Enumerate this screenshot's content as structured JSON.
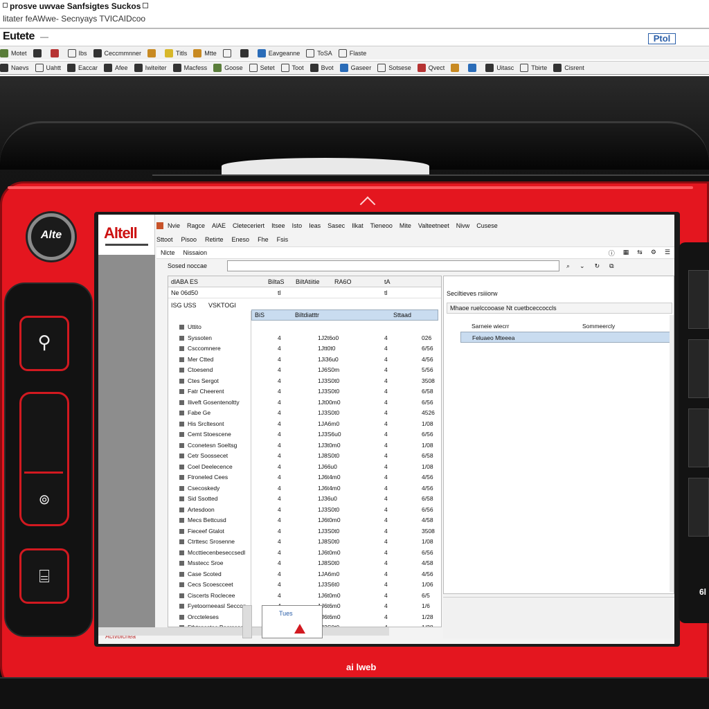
{
  "window": {
    "title": "prosve uwvae Sanfsigtes Suckos",
    "subtitle": "litater feAWwe- Secnyays TVICAIDcoo"
  },
  "brand": {
    "logo": "Eutete",
    "dash": "—",
    "right_badge": "Ptol"
  },
  "toolbar1": [
    {
      "label": "Motet",
      "icon": "g"
    },
    {
      "label": "",
      "icon": "d"
    },
    {
      "label": "",
      "icon": "r"
    },
    {
      "label": "Ibs",
      "icon": "k"
    },
    {
      "label": "Ceccmmnner",
      "icon": "d"
    },
    {
      "label": "",
      "icon": "o"
    },
    {
      "label": "Titls",
      "icon": "y"
    },
    {
      "label": "Mtte",
      "icon": "o"
    },
    {
      "label": "",
      "icon": "k"
    },
    {
      "label": "",
      "icon": "d"
    },
    {
      "label": "Eavgeanne",
      "icon": "b"
    },
    {
      "label": "ToSA",
      "icon": "k"
    },
    {
      "label": "Flaste",
      "icon": "k"
    }
  ],
  "toolbar2": [
    {
      "label": "Naevs",
      "icon": "d"
    },
    {
      "label": "Uahtt",
      "icon": "k"
    },
    {
      "label": "Eaccar",
      "icon": "d"
    },
    {
      "label": "Afee",
      "icon": "d"
    },
    {
      "label": "Iwiteiter",
      "icon": "d"
    },
    {
      "label": "Macfess",
      "icon": "d"
    },
    {
      "label": "Goose",
      "icon": "g"
    },
    {
      "label": "Setet",
      "icon": "k"
    },
    {
      "label": "Toot",
      "icon": "k"
    },
    {
      "label": "Bvot",
      "icon": "d"
    },
    {
      "label": "Gaseer",
      "icon": "b"
    },
    {
      "label": "Sotsese",
      "icon": "k"
    },
    {
      "label": "Qvect",
      "icon": "r"
    },
    {
      "label": "",
      "icon": "o"
    },
    {
      "label": "",
      "icon": "b"
    },
    {
      "label": "Uitasc",
      "icon": "d"
    },
    {
      "label": "Tbirte",
      "icon": "k"
    },
    {
      "label": "Cisrent",
      "icon": "d"
    }
  ],
  "device": {
    "knob_label": "Alte",
    "bottom_brand": "ai lweb",
    "side_badge": "6l",
    "btn1_glyph": "⚲",
    "btn2_glyph": "⊚",
    "btn3_glyph": "⌸"
  },
  "app": {
    "logo": "Altell",
    "menu": [
      "Nvie",
      "Ragce",
      "AlAE",
      "Cleteceriert",
      "Itsee",
      "Isto",
      "Ieas",
      "Sasec",
      "Ilkat",
      "Tieneoo",
      "Mite",
      "Valteetneet",
      "Nivw",
      "Cusese"
    ],
    "sub_menu": [
      "Sttoot",
      "Pisoo",
      "Retirte",
      "Eneso",
      "Fhe",
      "Fsis"
    ],
    "toolrow": [
      "Nlcte",
      "Nissaion"
    ],
    "search_label": "Sosed noccae",
    "search_value": "",
    "left_header": [
      "dlABA ES",
      "BiltaS",
      "BiltAtiitie",
      "RA6O",
      "tA"
    ],
    "left_row2": [
      "Ne 06d50",
      "tl",
      "tl"
    ],
    "filter": [
      "ISG",
      "USS",
      "VSK",
      "TOGI"
    ],
    "col_head": [
      "BiS",
      "Biltdiatttr",
      "Sttaad"
    ],
    "rows": [
      {
        "name": "Uttito",
        "v1": "",
        "v2": "",
        "v3": "",
        "v4": ""
      },
      {
        "name": "Syssoten",
        "v1": "4",
        "v2": "1J2t6o0",
        "v3": "4",
        "v4": "026"
      },
      {
        "name": "Csccomnere",
        "v1": "4",
        "v2": "1Jtt0t0",
        "v3": "4",
        "v4": "6/56"
      },
      {
        "name": "Mer Ctted",
        "v1": "4",
        "v2": "1Ji36u0",
        "v3": "4",
        "v4": "4/56"
      },
      {
        "name": "Ctoesend",
        "v1": "4",
        "v2": "1J6S0m",
        "v3": "4",
        "v4": "5/56"
      },
      {
        "name": "Ctes Sergot",
        "v1": "4",
        "v2": "1J3S0t0",
        "v3": "4",
        "v4": "3508"
      },
      {
        "name": "Fatr Cheerent",
        "v1": "4",
        "v2": "1J3S0t0",
        "v3": "4",
        "v4": "6/58"
      },
      {
        "name": "Iliveft Gosentenoltty",
        "v1": "4",
        "v2": "1Jt00m0",
        "v3": "4",
        "v4": "6/56"
      },
      {
        "name": "Fabe Ge",
        "v1": "4",
        "v2": "1J3S0t0",
        "v3": "4",
        "v4": "4526"
      },
      {
        "name": "His Srcltesont",
        "v1": "4",
        "v2": "1JA6m0",
        "v3": "4",
        "v4": "1/08"
      },
      {
        "name": "Cemt Stoescene",
        "v1": "4",
        "v2": "1J3S6u0",
        "v3": "4",
        "v4": "6/56"
      },
      {
        "name": "Cconetesn Soeltsg",
        "v1": "4",
        "v2": "1J3t0m0",
        "v3": "4",
        "v4": "1/08"
      },
      {
        "name": "Cetr Soossecet",
        "v1": "4",
        "v2": "1J8S0t0",
        "v3": "4",
        "v4": "6/58"
      },
      {
        "name": "Coel Deelecence",
        "v1": "4",
        "v2": "1J66u0",
        "v3": "4",
        "v4": "1/08"
      },
      {
        "name": "Ftroneled Cees",
        "v1": "4",
        "v2": "1J6t4m0",
        "v3": "4",
        "v4": "4/56"
      },
      {
        "name": "Csecoskedy",
        "v1": "4",
        "v2": "1J6t4m0",
        "v3": "4",
        "v4": "4/56"
      },
      {
        "name": "Sid Ssotted",
        "v1": "4",
        "v2": "1J36u0",
        "v3": "4",
        "v4": "6/58"
      },
      {
        "name": "Artesdoon",
        "v1": "4",
        "v2": "1J3S0t0",
        "v3": "4",
        "v4": "6/56"
      },
      {
        "name": "Mecs Bettcusd",
        "v1": "4",
        "v2": "1J6t0m0",
        "v3": "4",
        "v4": "4/58"
      },
      {
        "name": "Fieceef Gtalot",
        "v1": "4",
        "v2": "1J3S0t0",
        "v3": "4",
        "v4": "3508"
      },
      {
        "name": "Ctrttesc Srosenne",
        "v1": "4",
        "v2": "1J8S0t0",
        "v3": "4",
        "v4": "1/08"
      },
      {
        "name": "Mccttiecenbeseccsedl",
        "v1": "4",
        "v2": "1J6t0m0",
        "v3": "4",
        "v4": "6/56"
      },
      {
        "name": "Msstecc Sroe",
        "v1": "4",
        "v2": "1J8S0t0",
        "v3": "4",
        "v4": "4/58"
      },
      {
        "name": "Case Scoted",
        "v1": "4",
        "v2": "1JA6m0",
        "v3": "4",
        "v4": "4/56"
      },
      {
        "name": "Cecs Scoescceet",
        "v1": "4",
        "v2": "1J3S6t0",
        "v3": "4",
        "v4": "1/06"
      },
      {
        "name": "Ciscerts Roclecee",
        "v1": "4",
        "v2": "1J6t0m0",
        "v3": "4",
        "v4": "6/5"
      },
      {
        "name": "Fyetoorneeasl Seccon",
        "v1": "4",
        "v2": "1J6t6m0",
        "v3": "4",
        "v4": "1/6"
      },
      {
        "name": "Orccteleses",
        "v1": "4",
        "v2": "1J6t6m0",
        "v3": "4",
        "v4": "1/28"
      },
      {
        "name": "Fthtsnsstec Becrcced",
        "v1": "4",
        "v2": "1J3S0t0",
        "v3": "4",
        "v4": "1/28"
      }
    ],
    "right_title": "Seciltieves rsiiiorw",
    "right_tab": "Mhaoe ruelccooase Nt cuetbceccoccls",
    "right_row1": [
      "Sarneie wiecrr",
      "Sommeercly"
    ],
    "right_row2": "Feluaeo Mteeea",
    "action_label": "Tues",
    "bottom_label": "Actvbicnea",
    "bottom_arrow": "V"
  }
}
